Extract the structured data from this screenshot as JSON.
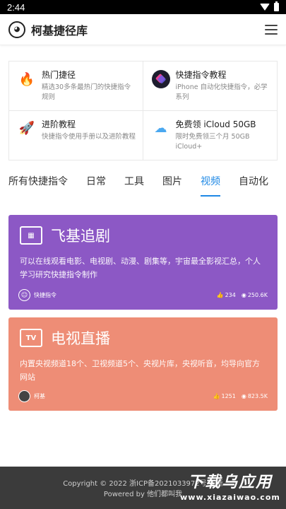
{
  "status": {
    "time": "2:44"
  },
  "appbar": {
    "title": "柯基捷径库"
  },
  "features": [
    {
      "icon": "fire-icon",
      "glyph": "🔥",
      "title": "热门捷径",
      "desc": "精选30多条最热门的快捷指令规则"
    },
    {
      "icon": "shortcuts-app-icon",
      "glyph": "◆",
      "title": "快捷指令教程",
      "desc": "iPhone 自动化快捷指令，必学系列"
    },
    {
      "icon": "rocket-icon",
      "glyph": "🚀",
      "title": "进阶教程",
      "desc": "快捷指令使用手册以及进阶教程"
    },
    {
      "icon": "cloud-icon",
      "glyph": "☁",
      "title": "免费领 iCloud 50GB",
      "desc": "限时免费领三个月 50GB iCloud+"
    }
  ],
  "tabs": [
    "所有快捷指令",
    "日常",
    "工具",
    "图片",
    "视频",
    "自动化"
  ],
  "active_tab": "视频",
  "cards": [
    {
      "icon": "film-icon",
      "title": "飞基追剧",
      "desc": "可以在线观看电影、电视剧、动漫、剧集等，宇宙最全影视汇总，个人学习研究快捷指令制作",
      "author": "快捷指令",
      "likes": "234",
      "views": "250.6K",
      "color": "#8c58c5"
    },
    {
      "icon": "tv-icon",
      "title": "电视直播",
      "desc": "内置央视频道18个、卫视频道5个、央视片库，央视听音，均导向官方网站",
      "author": "柯基",
      "likes": "1251",
      "views": "823.5K",
      "color": "#ee8d76"
    }
  ],
  "footer": {
    "line1": "Copyright © 2022 浙ICP备2021033972号-3 浙",
    "line2": "Powered by 他们都叫我"
  },
  "watermark": {
    "line1": "下载乌应用",
    "line2": "www.xiazaiwao.com"
  }
}
